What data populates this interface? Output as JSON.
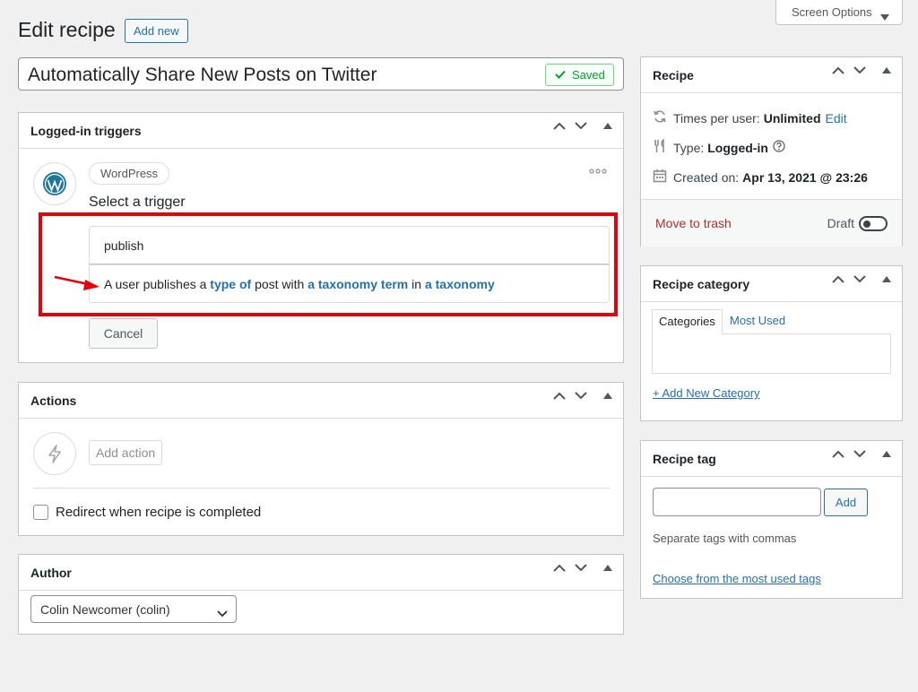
{
  "screen_options": {
    "label": "Screen Options"
  },
  "page": {
    "title": "Edit recipe",
    "add_new": "Add new"
  },
  "recipe_title": {
    "value": "Automatically Share New Posts on Twitter",
    "saved_label": "Saved"
  },
  "triggers": {
    "title": "Logged-in triggers",
    "integration_tag": "WordPress",
    "select_label": "Select a trigger",
    "search_value": "publish",
    "result": {
      "part1": "A user publishes a ",
      "link1": "type of",
      "part2": " post with ",
      "link2": "a taxonomy term",
      "part3": " in ",
      "link3": "a taxonomy"
    },
    "cancel": "Cancel"
  },
  "actions": {
    "title": "Actions",
    "add_action": "Add action",
    "redirect_label": "Redirect when recipe is completed"
  },
  "author": {
    "title": "Author",
    "selected": "Colin Newcomer (colin)"
  },
  "recipe_box": {
    "title": "Recipe",
    "times_label": "Times per user:",
    "times_value": "Unlimited",
    "edit": "Edit",
    "type_label": "Type:",
    "type_value": "Logged-in",
    "created_label": "Created on:",
    "created_value": "Apr 13, 2021 @ 23:26",
    "trash": "Move to trash",
    "status": "Draft"
  },
  "category": {
    "title": "Recipe category",
    "tab_categories": "Categories",
    "tab_most_used": "Most Used",
    "add_new": "+ Add New Category"
  },
  "tag": {
    "title": "Recipe tag",
    "add": "Add",
    "hint": "Separate tags with commas",
    "choose": "Choose from the most used tags"
  },
  "colors": {
    "accent": "#2271b1",
    "highlight": "#e8000b",
    "saved": "#00a32a",
    "trash": "#b32d2e"
  }
}
